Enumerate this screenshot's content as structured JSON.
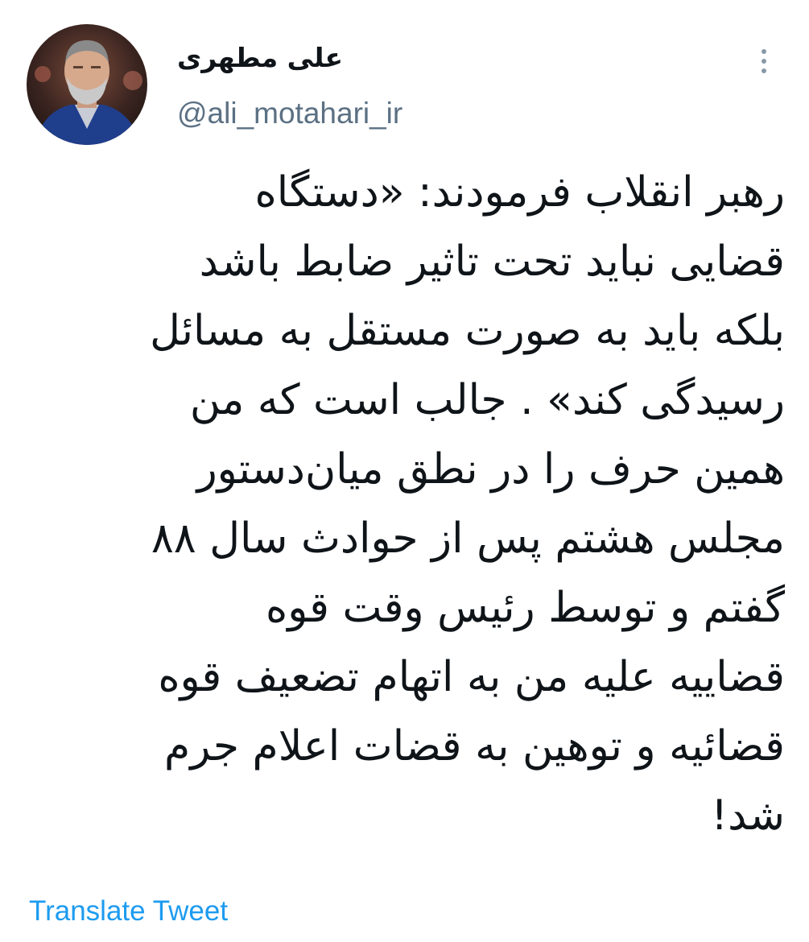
{
  "author": {
    "display_name": "علی مطهری",
    "handle": "@ali_motahari_ir",
    "avatar_icon": "profile-photo"
  },
  "menu": {
    "icon": "more-vertical-icon"
  },
  "tweet": {
    "lines": [
      "رهبر انقلاب فرمودند: «دستگاه",
      "قضایی نباید تحت تاثیر ضابط باشد",
      "بلکه باید به صورت مستقل به مسائل",
      "رسیدگی کند» . جالب است که من",
      "همین حرف را در نطق میان‌دستور",
      "مجلس هشتم پس از حوادث سال ۸۸",
      "گفتم و توسط رئیس وقت قوه",
      "قضاییه علیه من به اتهام تضعیف قوه",
      "قضائیه و توهین به قضات اعلام جرم",
      "شد!"
    ]
  },
  "actions": {
    "translate_label": "Translate Tweet"
  },
  "colors": {
    "text": "#0f1419",
    "handle": "#5b7083",
    "link": "#1d9bf0",
    "background": "#ffffff"
  }
}
